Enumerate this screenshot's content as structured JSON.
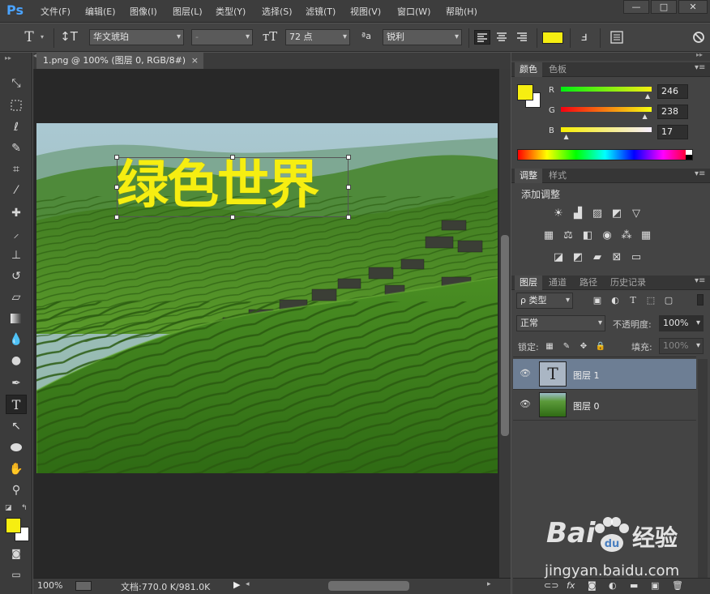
{
  "app": {
    "logo": "Ps"
  },
  "menu": [
    "文件(F)",
    "编辑(E)",
    "图像(I)",
    "图层(L)",
    "类型(Y)",
    "选择(S)",
    "滤镜(T)",
    "视图(V)",
    "窗口(W)",
    "帮助(H)"
  ],
  "window_controls": [
    "—",
    "□",
    "✕"
  ],
  "options": {
    "font_family": "华文琥珀",
    "font_style": "-",
    "font_size": "72 点",
    "aa_label": "ªa",
    "antialias": "锐利",
    "text_color": "#f6ee11"
  },
  "document": {
    "tab_title": "1.png @ 100% (图层 0, RGB/8#)",
    "close": "×"
  },
  "canvas": {
    "text": "绿色世界",
    "text_color": "#f6ee11"
  },
  "status": {
    "zoom": "100%",
    "doc_size": "文档:770.0 K/981.0K"
  },
  "color_panel": {
    "tabs": [
      "颜色",
      "色板"
    ],
    "fg": "#f6ee11",
    "bg": "#ffffff",
    "channels": [
      {
        "label": "R",
        "value": "246"
      },
      {
        "label": "G",
        "value": "238"
      },
      {
        "label": "B",
        "value": "17"
      }
    ]
  },
  "adjust_panel": {
    "tabs": [
      "调整",
      "样式"
    ],
    "title": "添加调整",
    "icons": [
      [
        "brightness-icon",
        "levels-icon",
        "curves-icon",
        "exposure-icon",
        "vibrance-icon"
      ],
      [
        "hue-sat-icon",
        "color-balance-icon",
        "bw-icon",
        "photo-filter-icon",
        "channel-mixer-icon",
        "color-lookup-icon"
      ],
      [
        "invert-icon",
        "posterize-icon",
        "threshold-icon",
        "selective-color-icon",
        "gradient-map-icon"
      ]
    ]
  },
  "layers_panel": {
    "tabs": [
      "图层",
      "通道",
      "路径",
      "历史记录"
    ],
    "filter": "ρ 类型",
    "blend_mode": "正常",
    "opacity_label": "不透明度:",
    "opacity": "100%",
    "lock_label": "锁定:",
    "fill_label": "填充:",
    "fill": "100%",
    "layers": [
      {
        "name": "图层 1",
        "type": "text",
        "thumb_glyph": "T",
        "selected": true
      },
      {
        "name": "图层 0",
        "type": "image",
        "selected": false
      }
    ]
  },
  "watermark": {
    "brand": "Bai",
    "brand2": "经验",
    "url": "jingyan.baidu.com"
  }
}
